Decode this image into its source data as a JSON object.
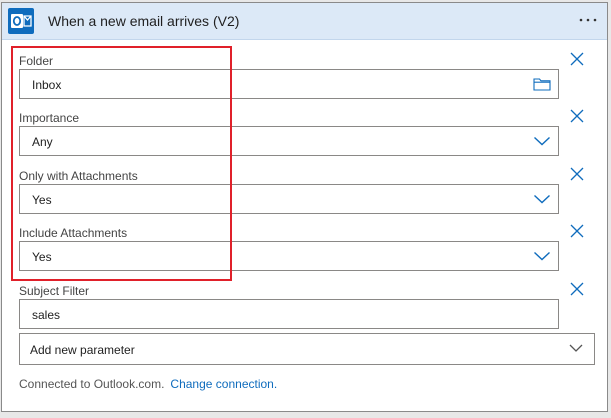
{
  "header": {
    "title": "When a new email arrives (V2)",
    "app_icon": "outlook-icon",
    "more_icon": "more-options-icon",
    "background_color": "#dce9f7"
  },
  "fields": [
    {
      "label": "Folder",
      "value": "Inbox",
      "icon": "folder-icon"
    },
    {
      "label": "Importance",
      "value": "Any",
      "icon": "chevron-down-icon"
    },
    {
      "label": "Only with Attachments",
      "value": "Yes",
      "icon": "chevron-down-icon"
    },
    {
      "label": "Include Attachments",
      "value": "Yes",
      "icon": "chevron-down-icon"
    },
    {
      "label": "Subject Filter",
      "value": "sales",
      "icon": ""
    }
  ],
  "add_parameter": {
    "label": "Add new parameter",
    "icon": "chevron-down-icon"
  },
  "footer": {
    "connected_text": "Connected to Outlook.com.",
    "change_link": "Change connection."
  },
  "colors": {
    "accent": "#0f6cbd",
    "highlight": "#e0202a"
  }
}
